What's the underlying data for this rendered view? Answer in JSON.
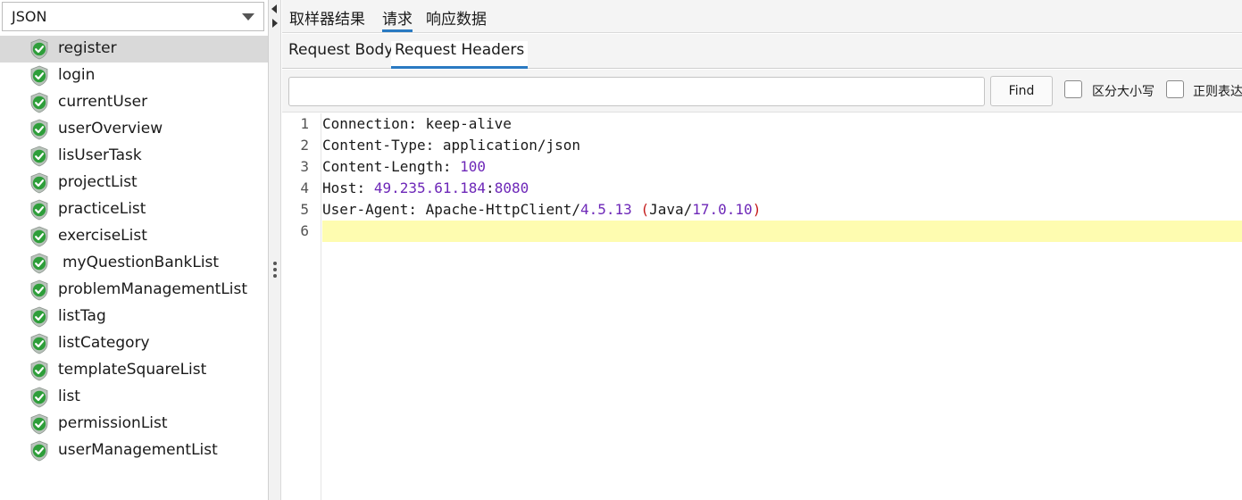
{
  "left_panel": {
    "renderer": "JSON",
    "items": [
      {
        "label": "register",
        "status": "success",
        "selected": true
      },
      {
        "label": "login",
        "status": "success"
      },
      {
        "label": "currentUser",
        "status": "success"
      },
      {
        "label": "userOverview",
        "status": "success"
      },
      {
        "label": "lisUserTask",
        "status": "success"
      },
      {
        "label": "projectList",
        "status": "success"
      },
      {
        "label": "practiceList",
        "status": "success"
      },
      {
        "label": "exerciseList",
        "status": "success"
      },
      {
        "label": "myQuestionBankList",
        "status": "success"
      },
      {
        "label": "problemManagementList",
        "status": "success"
      },
      {
        "label": "listTag",
        "status": "success"
      },
      {
        "label": "listCategory",
        "status": "success"
      },
      {
        "label": "templateSquareList",
        "status": "success"
      },
      {
        "label": "list",
        "status": "success"
      },
      {
        "label": "permissionList",
        "status": "success"
      },
      {
        "label": "userManagementList",
        "status": "success"
      }
    ]
  },
  "main_tabs": [
    {
      "label": "取样器结果"
    },
    {
      "label": "请求",
      "active": true
    },
    {
      "label": "响应数据"
    }
  ],
  "sub_tabs": [
    {
      "label": "Request Body"
    },
    {
      "label": "Request Headers",
      "active": true
    }
  ],
  "search": {
    "value": "",
    "find_label": "Find",
    "case_sensitive_label": "区分大小写",
    "regex_label": "正则表达"
  },
  "editor": {
    "line_numbers": [
      "1",
      "2",
      "3",
      "4",
      "5",
      "6"
    ],
    "lines": {
      "l1_key": "Connection:",
      "l1_val": " keep-alive",
      "l2_key": "Content-Type:",
      "l2_val": " application/json",
      "l3_key": "Content-Length:",
      "l3_val": "100",
      "l4_key": "Host:",
      "l4_val": "49.235.61.184",
      "l4_port": "8080",
      "l5_key": "User-Agent:",
      "l5_val": " Apache-HttpClient/",
      "l5_ver": "4.5.13",
      "l5_open": "(",
      "l5_java": "Java/",
      "l5_jver": "17.0.10",
      "l5_close": ")"
    },
    "current_line": 6
  },
  "colors": {
    "accent": "#2a7ac2",
    "success_icon": "#2e9e3a",
    "number_purple": "#6d27b8",
    "paren_red": "#c41a1a",
    "current_line_bg": "#fefcb0"
  }
}
